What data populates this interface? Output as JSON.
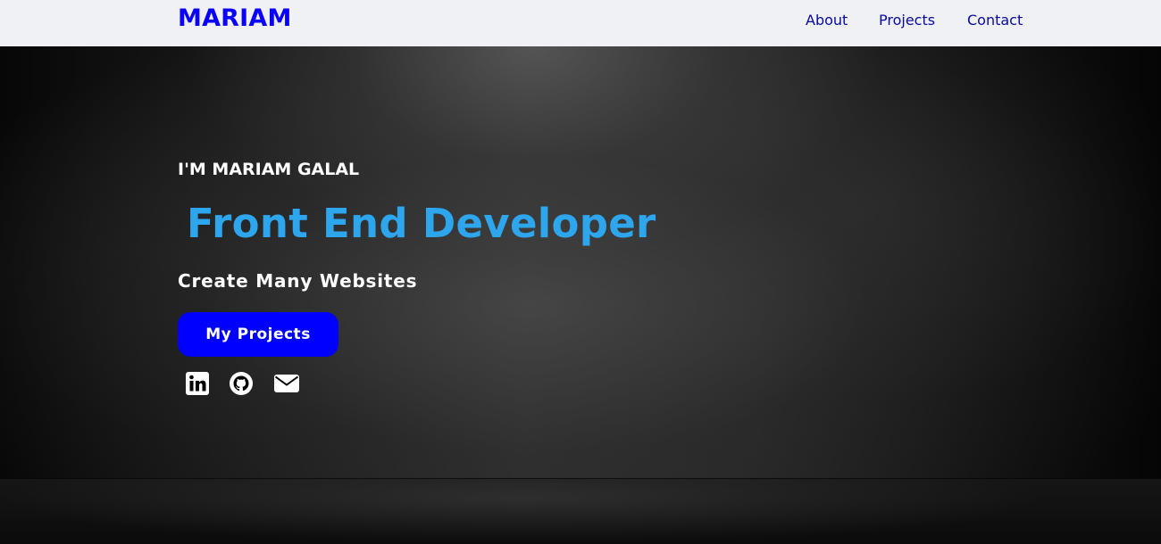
{
  "navbar": {
    "brand": "MARIAM",
    "links": [
      {
        "label": "About"
      },
      {
        "label": "Projects"
      },
      {
        "label": "Contact"
      }
    ]
  },
  "hero": {
    "intro": "I'M MARIAM GALAL",
    "role": "Front End Developer",
    "tagline": "Create Many Websites",
    "cta_label": "My Projects",
    "social_icons": [
      "linkedin-icon",
      "github-icon",
      "mail-icon"
    ]
  },
  "colors": {
    "brand": "#0a00ff",
    "nav_link": "#0a0aa0",
    "navbar_bg": "#f0f1f4",
    "role_text": "#2ea6ee",
    "cta_bg": "#0000ff"
  }
}
